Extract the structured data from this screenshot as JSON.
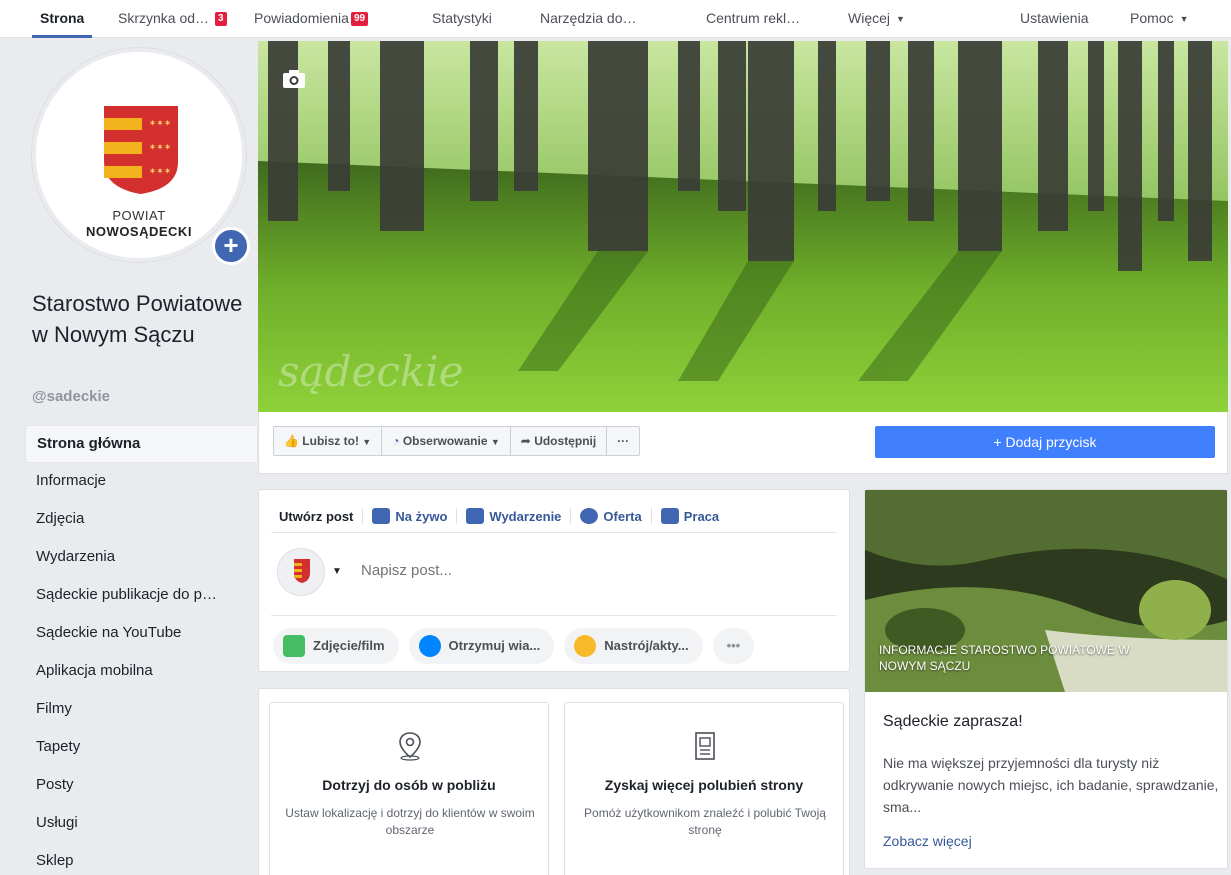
{
  "topnav": {
    "tabs": [
      {
        "label": "Strona",
        "active": true
      },
      {
        "label": "Skrzynka od…",
        "badge": "3"
      },
      {
        "label": "Powiadomienia",
        "badge": "99"
      },
      {
        "label": "Statystyki"
      },
      {
        "label": "Narzędzia do…"
      },
      {
        "label": "Centrum rekl…"
      },
      {
        "label": "Więcej",
        "caret": "▼"
      },
      {
        "label": "Ustawienia"
      },
      {
        "label": "Pomoc",
        "caret": "▼"
      }
    ]
  },
  "page": {
    "logo_line1": "POWIAT",
    "logo_line2": "NOWOSĄDECKI",
    "add_symbol": "+",
    "name": "Starostwo Powiatowe w Nowym Sączu",
    "handle": "@sadeckie"
  },
  "sidebar": {
    "items": [
      {
        "label": "Strona główna",
        "active": true
      },
      {
        "label": "Informacje"
      },
      {
        "label": "Zdjęcia"
      },
      {
        "label": "Wydarzenia"
      },
      {
        "label": "Sądeckie publikacje do p…"
      },
      {
        "label": "Sądeckie na YouTube"
      },
      {
        "label": "Aplikacja mobilna"
      },
      {
        "label": "Filmy"
      },
      {
        "label": "Tapety"
      },
      {
        "label": "Posty"
      },
      {
        "label": "Usługi"
      },
      {
        "label": "Sklep"
      }
    ]
  },
  "cover": {
    "watermark": "sądeckie"
  },
  "actions": {
    "like": "Lubisz to!",
    "follow": "Obserwowanie",
    "share": "Udostępnij",
    "more": "···",
    "add_button": "+ Dodaj przycisk"
  },
  "composer": {
    "tabs": [
      {
        "label": "Utwórz post",
        "icon": "none"
      },
      {
        "label": "Na żywo",
        "icon": "live-video-icon",
        "color": "#4267b2"
      },
      {
        "label": "Wydarzenie",
        "icon": "calendar-icon",
        "color": "#4267b2"
      },
      {
        "label": "Oferta",
        "icon": "offer-tag-icon",
        "color": "#4267b2"
      },
      {
        "label": "Praca",
        "icon": "briefcase-icon",
        "color": "#4267b2"
      }
    ],
    "placeholder": "Napisz post...",
    "pills": [
      {
        "label": "Zdjęcie/film",
        "icon": "photo-icon",
        "color": "#45bd62"
      },
      {
        "label": "Otrzymuj wia...",
        "icon": "messenger-icon",
        "color": "#0084ff"
      },
      {
        "label": "Nastrój/akty...",
        "icon": "emoji-icon",
        "color": "#f7b928"
      },
      {
        "label": "•••",
        "icon": "none"
      }
    ]
  },
  "tips": [
    {
      "title": "Dotrzyj do osób w pobliżu",
      "desc": "Ustaw lokalizację i dotrzyj do klientów w swoim obszarze",
      "icon": "location-pin-icon"
    },
    {
      "title": "Zyskaj więcej polubień strony",
      "desc": "Pomóż użytkownikom znaleźć i polubić Twoją stronę",
      "icon": "page-icon"
    }
  ],
  "info_card": {
    "image_caption": "INFORMACJE STAROSTWO POWIATOWE W NOWYM SĄCZU",
    "title": "Sądeckie zaprasza!",
    "description": "Nie ma większej przyjemności dla turysty niż odkrywanie nowych miejsc, ich badanie, sprawdzanie, sma...",
    "link": "Zobacz więcej"
  },
  "colors": {
    "accent": "#4267b2",
    "button_blue": "#4080ff",
    "link": "#365899",
    "badge_red": "#e41e3f"
  }
}
